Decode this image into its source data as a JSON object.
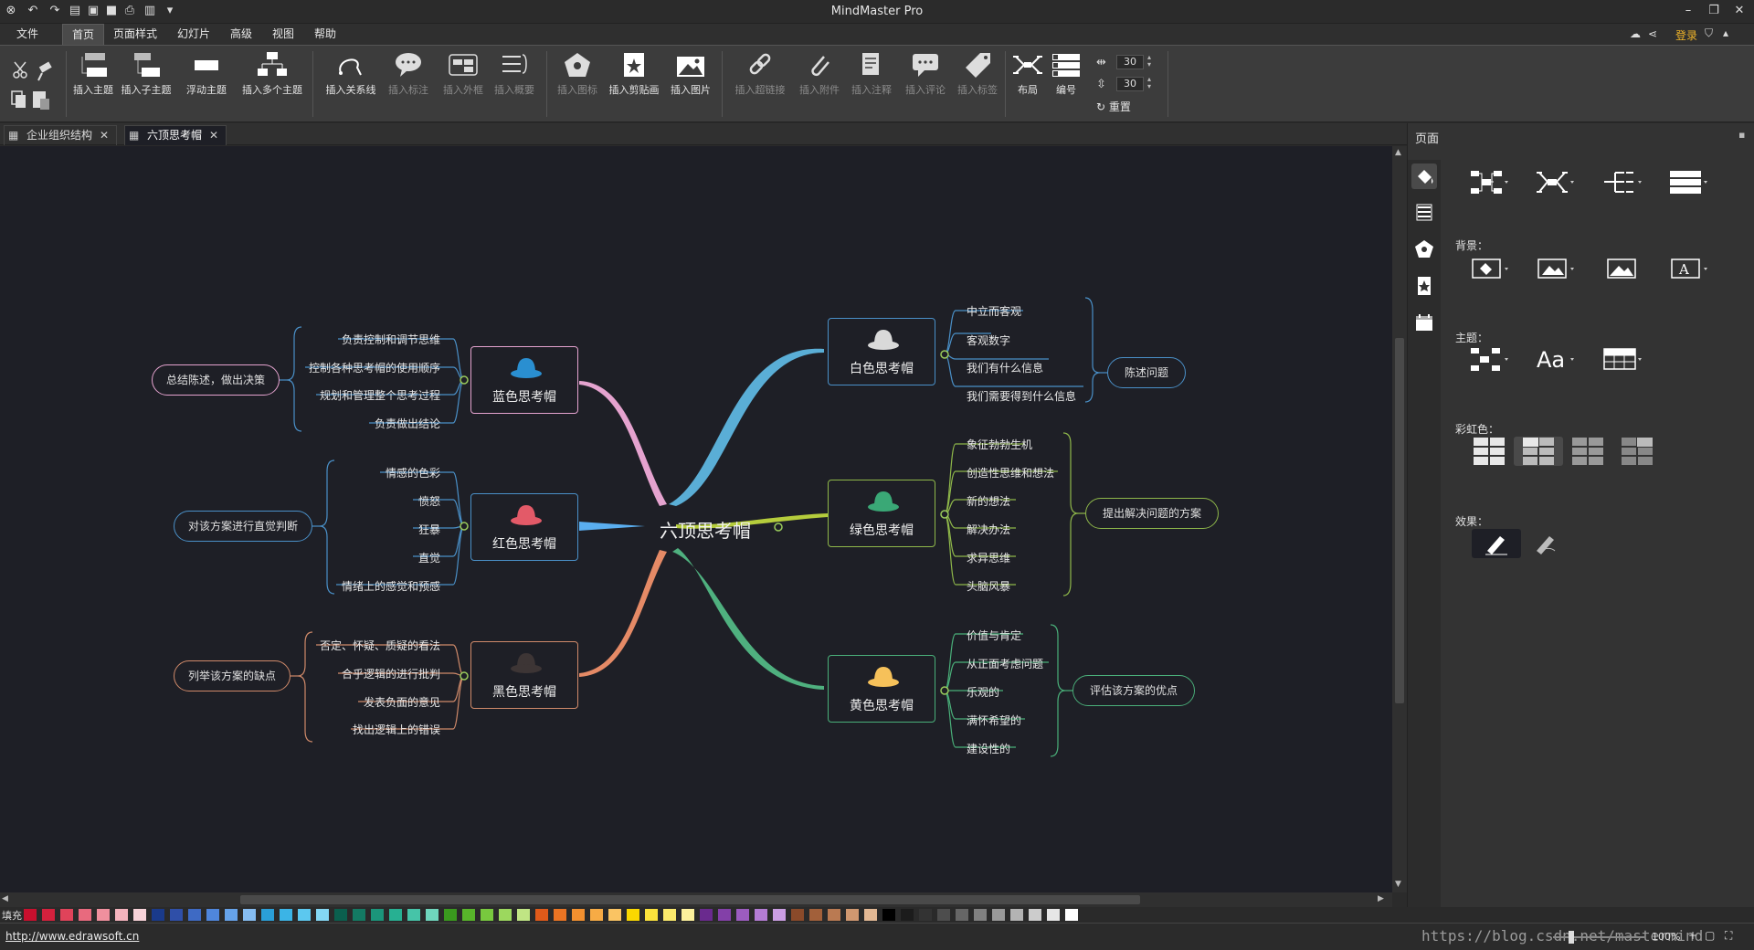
{
  "window": {
    "title": "MindMaster Pro",
    "login": "登录"
  },
  "menu": [
    "文件",
    "首页",
    "页面样式",
    "幻灯片",
    "高级",
    "视图",
    "帮助"
  ],
  "ribbon": {
    "insert_topic": "插入主题",
    "insert_subtopic": "插入子主题",
    "float_topic": "浮动主题",
    "insert_multi": "插入多个主题",
    "insert_relation": "插入关系线",
    "insert_callout": "插入标注",
    "insert_boundary": "插入外框",
    "insert_summary": "插入概要",
    "insert_icon": "插入图标",
    "insert_clipart": "插入剪贴画",
    "insert_image": "插入图片",
    "insert_hyperlink": "插入超链接",
    "insert_attachment": "插入附件",
    "insert_note": "插入注释",
    "insert_comment": "插入评论",
    "insert_tag": "插入标签",
    "layout": "布局",
    "numbering": "编号",
    "spacing_h": "30",
    "spacing_v": "30",
    "reset": "重置"
  },
  "tabs": [
    {
      "label": "企业组织结构"
    },
    {
      "label": "六顶思考帽"
    }
  ],
  "map": {
    "central": "六顶思考帽",
    "hats": {
      "white": "白色思考帽",
      "green": "绿色思考帽",
      "yellow": "黄色思考帽",
      "blue": "蓝色思考帽",
      "red": "红色思考帽",
      "black": "黑色思考帽"
    },
    "summaries": {
      "white": "陈述问题",
      "green": "提出解决问题的方案",
      "yellow": "评估该方案的优点",
      "blue": "总结陈述，做出决策",
      "red": "对该方案进行直觉判断",
      "black": "列举该方案的缺点"
    },
    "white_items": [
      "中立而客观",
      "客观数字",
      "我们有什么信息",
      "我们需要得到什么信息"
    ],
    "green_items": [
      "象征勃勃生机",
      "创造性思维和想法",
      "新的想法",
      "解决办法",
      "求异思维",
      "头脑风暴"
    ],
    "yellow_items": [
      "价值与肯定",
      "从正面考虑问题",
      "乐观的",
      "满怀希望的",
      "建设性的"
    ],
    "blue_items": [
      "负责控制和调节思维",
      "控制各种思考帽的使用顺序",
      "规划和管理整个思考过程",
      "负责做出结论"
    ],
    "red_items": [
      "情感的色彩",
      "愤怒",
      "狂暴",
      "直觉",
      "情绪上的感觉和预感"
    ],
    "black_items": [
      "否定、怀疑、质疑的看法",
      "合乎逻辑的进行批判",
      "发表负面的意见",
      "找出逻辑上的错误"
    ]
  },
  "colors": {
    "white": "#d9d9d9",
    "green": "#3aa876",
    "yellow": "#f6c15a",
    "blue": "#2a8fd1",
    "red": "#e35a68",
    "black": "#3d3535"
  },
  "panel": {
    "title": "页面",
    "background": "背景：",
    "theme": "主题：",
    "rainbow": "彩虹色：",
    "effect": "效果："
  },
  "palette_label": "填充",
  "status": {
    "url": "http://www.edrawsoft.cn",
    "zoom": "100%",
    "watermark": "https://blog.csdn.net/mastermind"
  }
}
